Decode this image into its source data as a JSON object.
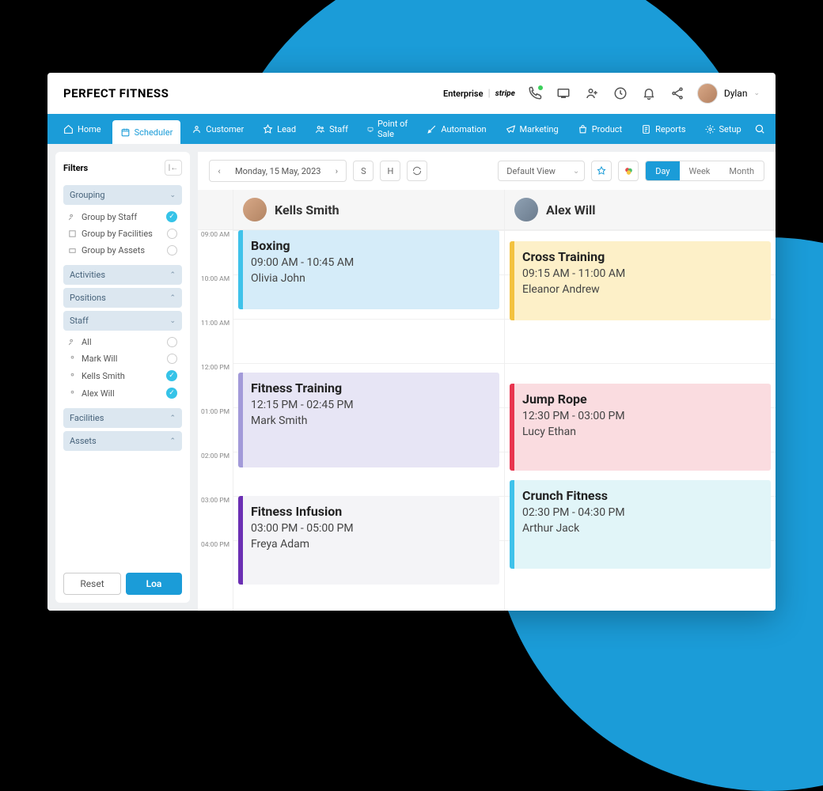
{
  "brand": "PERFECT FITNESS",
  "header": {
    "plan": "Enterprise",
    "payment": "stripe",
    "user": "Dylan"
  },
  "nav": {
    "home": "Home",
    "scheduler": "Scheduler",
    "customer": "Customer",
    "lead": "Lead",
    "staff": "Staff",
    "pos": "Point of Sale",
    "automation": "Automation",
    "marketing": "Marketing",
    "product": "Product",
    "reports": "Reports",
    "setup": "Setup"
  },
  "filters": {
    "title": "Filters",
    "grouping": {
      "title": "Grouping",
      "by_staff": "Group by Staff",
      "by_facilities": "Group by Facilities",
      "by_assets": "Group by Assets"
    },
    "activities": "Activities",
    "positions": "Positions",
    "staff": {
      "title": "Staff",
      "all": "All",
      "m1": "Mark Will",
      "m2": "Kells Smith",
      "m3": "Alex Will"
    },
    "facilities": "Facilities",
    "assets": "Assets",
    "reset": "Reset",
    "load": "Loa"
  },
  "toolbar": {
    "date": "Monday, 15 May, 2023",
    "s": "S",
    "h": "H",
    "default_view": "Default View",
    "day": "Day",
    "week": "Week",
    "month": "Month"
  },
  "columns": {
    "c1": "Kells Smith",
    "c2": "Alex  Will"
  },
  "times": {
    "t9": "09:00 AM",
    "t10": "10:00 AM",
    "t11": "11:00 AM",
    "t12": "12:00 PM",
    "t13": "01:00 PM",
    "t14": "02:00 PM",
    "t15": "03:00 PM",
    "t16": "04:00 PM"
  },
  "events": {
    "boxing": {
      "title": "Boxing",
      "time": "09:00 AM - 10:45 AM",
      "who": "Olivia John"
    },
    "fit": {
      "title": "Fitness Training",
      "time": "12:15 PM - 02:45 PM",
      "who": "Mark Smith"
    },
    "inf": {
      "title": "Fitness Infusion",
      "time": "03:00 PM - 05:00 PM",
      "who": "Freya Adam"
    },
    "cross": {
      "title": "Cross Training",
      "time": "09:15 AM - 11:00 AM",
      "who": "Eleanor Andrew"
    },
    "jump": {
      "title": "Jump Rope",
      "time": "12:30 PM - 03:00 PM",
      "who": "Lucy Ethan"
    },
    "crunch": {
      "title": "Crunch Fitness",
      "time": "02:30 PM - 04:30 PM",
      "who": "Arthur Jack"
    }
  }
}
